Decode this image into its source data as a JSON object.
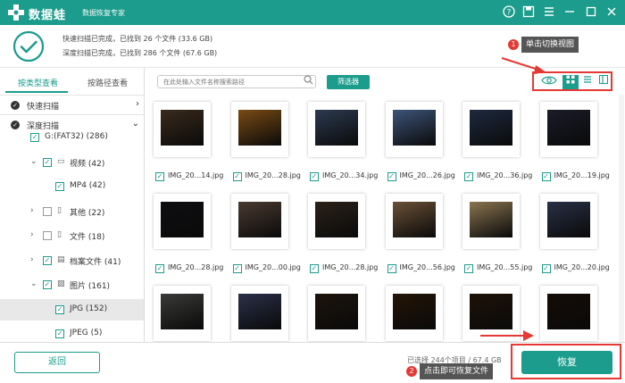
{
  "app": {
    "name": "数据蛙",
    "subtitle": "数据恢复专家"
  },
  "summary": {
    "line1": "快速扫描已完成，已找到 26 个文件 (33.6 GB)",
    "line2": "深度扫描已完成，已找到 286 个文件 (67.6 GB)"
  },
  "sidebar": {
    "tabs": [
      "按类型查看",
      "按路径查看"
    ],
    "scans": [
      "快速扫描",
      "深度扫描"
    ],
    "tree": [
      {
        "label": "G:(FAT32) (286)",
        "checked": true,
        "caret": "",
        "icon": "",
        "indent": 0,
        "selected": false
      },
      {
        "label": "视频 (42)",
        "checked": true,
        "caret": "v",
        "icon": "folder",
        "indent": 1,
        "selected": false
      },
      {
        "label": "MP4 (42)",
        "checked": true,
        "caret": "",
        "icon": "",
        "indent": 2,
        "selected": false
      },
      {
        "label": "其他 (22)",
        "checked": false,
        "caret": ">",
        "icon": "doc",
        "indent": 1,
        "selected": false
      },
      {
        "label": "文件 (18)",
        "checked": false,
        "caret": ">",
        "icon": "doc",
        "indent": 1,
        "selected": false
      },
      {
        "label": "档案文件 (41)",
        "checked": true,
        "caret": ">",
        "icon": "archive",
        "indent": 1,
        "selected": false
      },
      {
        "label": "图片 (161)",
        "checked": true,
        "caret": "v",
        "icon": "image",
        "indent": 1,
        "selected": false
      },
      {
        "label": "JPG (152)",
        "checked": true,
        "caret": "",
        "icon": "",
        "indent": 2,
        "selected": true
      },
      {
        "label": "JPEG (5)",
        "checked": true,
        "caret": "",
        "icon": "",
        "indent": 2,
        "selected": false
      }
    ]
  },
  "toolbar": {
    "search_placeholder": "在此处输入文件名称搜索路径",
    "filter_label": "筛选器"
  },
  "files": [
    {
      "name": "IMG_20...14.jpg",
      "tone": "#3a2a1c"
    },
    {
      "name": "IMG_20...28.jpg",
      "tone": "#7a4a14"
    },
    {
      "name": "IMG_20...34.jpg",
      "tone": "#2c3a50"
    },
    {
      "name": "IMG_20...26.jpg",
      "tone": "#3d5478"
    },
    {
      "name": "IMG_20...36.jpg",
      "tone": "#1e2a40"
    },
    {
      "name": "IMG_20...19.jpg",
      "tone": "#1a1c28"
    },
    {
      "name": "IMG_20...28.jpg",
      "tone": "#0e0e12"
    },
    {
      "name": "IMG_20...00.jpg",
      "tone": "#4a3a30"
    },
    {
      "name": "IMG_20...28.jpg",
      "tone": "#2a2218"
    },
    {
      "name": "IMG_20...56.jpg",
      "tone": "#6a5036"
    },
    {
      "name": "IMG_20...55.jpg",
      "tone": "#8a7450"
    },
    {
      "name": "IMG_20...20.jpg",
      "tone": "#2a3046"
    },
    {
      "name": "",
      "tone": "#3a3a38"
    },
    {
      "name": "",
      "tone": "#2a3048"
    },
    {
      "name": "",
      "tone": "#1c140c"
    },
    {
      "name": "",
      "tone": "#241406"
    },
    {
      "name": "",
      "tone": "#1e1208"
    },
    {
      "name": "",
      "tone": "#140c06"
    }
  ],
  "footer": {
    "back_label": "返回",
    "selected_info": "已选择 244个项目 / 67.4 GB",
    "recover_label": "恢复"
  },
  "callouts": [
    {
      "number": "1",
      "text": "单击切换视图"
    },
    {
      "number": "2",
      "text": "点击即可恢复文件"
    }
  ],
  "colors": {
    "accent": "#1c9c8c",
    "highlight": "#e53935"
  }
}
